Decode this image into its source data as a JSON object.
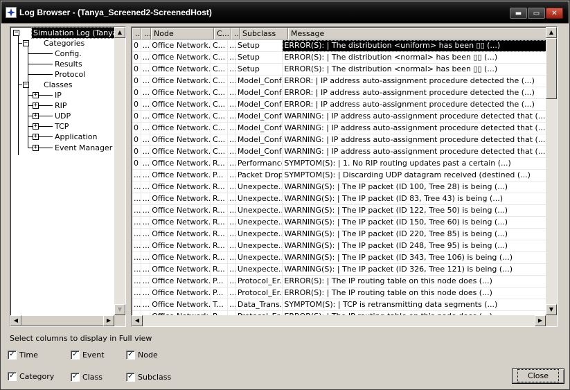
{
  "window": {
    "title": "Log Browser - (Tanya_Screened2-ScreenedHost)",
    "minimize": "▬",
    "maximize": "▭",
    "close": "✕"
  },
  "tree": {
    "root": "Simulation Log (Tanya_S",
    "categories": "Categories",
    "config": "Config.",
    "results": "Results",
    "protocol": "Protocol",
    "classes": "Classes",
    "ip": "IP",
    "rip": "RIP",
    "udp": "UDP",
    "tcp": "TCP",
    "application": "Application",
    "event_manager": "Event Manager"
  },
  "grid": {
    "columns": [
      "...",
      "...",
      "Node",
      "C...",
      "...",
      "Subclass",
      "Message"
    ],
    "rows": [
      [
        "0",
        "...",
        "Office Network.I...",
        "C...",
        "...",
        "Setup",
        "ERROR(S):  |  The distribution <uniform> has been ▯▯  (...)"
      ],
      [
        "0",
        "...",
        "Office Network.I...",
        "C...",
        "...",
        "Setup",
        "ERROR(S):  |  The distribution <normal> has been ▯▯  (...)"
      ],
      [
        "0",
        "...",
        "Office Network.I...",
        "C...",
        "...",
        "Setup",
        "ERROR(S):  |  The distribution <normal> has been ▯▯  (...)"
      ],
      [
        "0",
        "...",
        "Office Network.I...",
        "C...",
        "...",
        "Model_Conf...",
        "ERROR:  |  IP address auto-assignment procedure detected the  (...)"
      ],
      [
        "0",
        "...",
        "Office Network.I...",
        "C...",
        "...",
        "Model_Conf...",
        "ERROR:  |  IP address auto-assignment procedure detected the  (...)"
      ],
      [
        "0",
        "...",
        "Office Network.I...",
        "C...",
        "...",
        "Model_Conf...",
        "ERROR:  |  IP address auto-assignment procedure detected the  (...)"
      ],
      [
        "0",
        "...",
        "Office Network.I...",
        "C...",
        "...",
        "Model_Conf...",
        "WARNING:  |  IP address auto-assignment procedure detected that  (...)"
      ],
      [
        "0",
        "...",
        "Office Network.I...",
        "C...",
        "...",
        "Model_Conf...",
        "WARNING:  |  IP address auto-assignment procedure detected that  (...)"
      ],
      [
        "0",
        "...",
        "Office Network.I...",
        "C...",
        "...",
        "Model_Conf...",
        "WARNING:  |  IP address auto-assignment procedure detected that  (...)"
      ],
      [
        "0",
        "...",
        "Office Network.I...",
        "C...",
        "...",
        "Model_Conf...",
        "WARNING:  |  IP address auto-assignment procedure detected that  (...)"
      ],
      [
        "0",
        "...",
        "Office Network.I...",
        "R...",
        "...",
        "Performance",
        "SYMPTOM(S):  |  1. No RIP routing updates past a certain  (...)"
      ],
      [
        "...",
        "...",
        "Office Network.I...",
        "P...",
        "...",
        "Packet Drop",
        "SYMPTOM(S):  |  Discarding UDP datagram received (destined  (...)"
      ],
      [
        "...",
        "...",
        "Office Network....",
        "R...",
        "...",
        "Unexpecte...",
        "WARNING(S):  |  The IP packet (ID 100, Tree 28) is being  (...)"
      ],
      [
        "...",
        "...",
        "Office Network....",
        "R...",
        "...",
        "Unexpecte...",
        "WARNING(S):  |  The IP packet (ID 83, Tree 43) is being  (...)"
      ],
      [
        "...",
        "...",
        "Office Network....",
        "R...",
        "...",
        "Unexpecte...",
        "WARNING(S):  |  The IP packet (ID 122, Tree 50) is being  (...)"
      ],
      [
        "...",
        "...",
        "Office Network....",
        "R...",
        "...",
        "Unexpecte...",
        "WARNING(S):  |  The IP packet (ID 150, Tree 60) is being  (...)"
      ],
      [
        "...",
        "...",
        "Office Network....",
        "R...",
        "...",
        "Unexpecte...",
        "WARNING(S):  |  The IP packet (ID 220, Tree 85) is being  (...)"
      ],
      [
        "...",
        "...",
        "Office Network....",
        "R...",
        "...",
        "Unexpecte...",
        "WARNING(S):  |  The IP packet (ID 248, Tree 95) is being  (...)"
      ],
      [
        "...",
        "...",
        "Office Network....",
        "R...",
        "...",
        "Unexpecte...",
        "WARNING(S):  |  The IP packet (ID 343, Tree 106) is being  (...)"
      ],
      [
        "...",
        "...",
        "Office Network....",
        "R...",
        "...",
        "Unexpecte...",
        "WARNING(S):  |  The IP packet (ID 326, Tree 121) is being  (...)"
      ],
      [
        "...",
        "...",
        "Office Network....",
        "P...",
        "...",
        "Protocol_Er...",
        "ERROR(S):  |  The IP routing table on this node does  (...)"
      ],
      [
        "...",
        "...",
        "Office Network.I...",
        "P...",
        "...",
        "Protocol_Er...",
        "ERROR(S):  |  The IP routing table on this node does  (...)"
      ],
      [
        "...",
        "...",
        "Office Network.I...",
        "T...",
        "...",
        "Data_Trans...",
        "SYMPTOM(S):  |  TCP is retransmitting data segments  (...)"
      ],
      [
        "...",
        "...",
        "Office Network.I...",
        "P...",
        "...",
        "Protocol_Er...",
        "ERROR(S):  |  The IP routing table on this node does  (...)"
      ]
    ]
  },
  "options": {
    "label": "Select columns to display in Full view",
    "time": "Time",
    "event": "Event",
    "node": "Node",
    "category": "Category",
    "class": "Class",
    "subclass": "Subclass"
  },
  "buttons": {
    "close": "Close"
  }
}
